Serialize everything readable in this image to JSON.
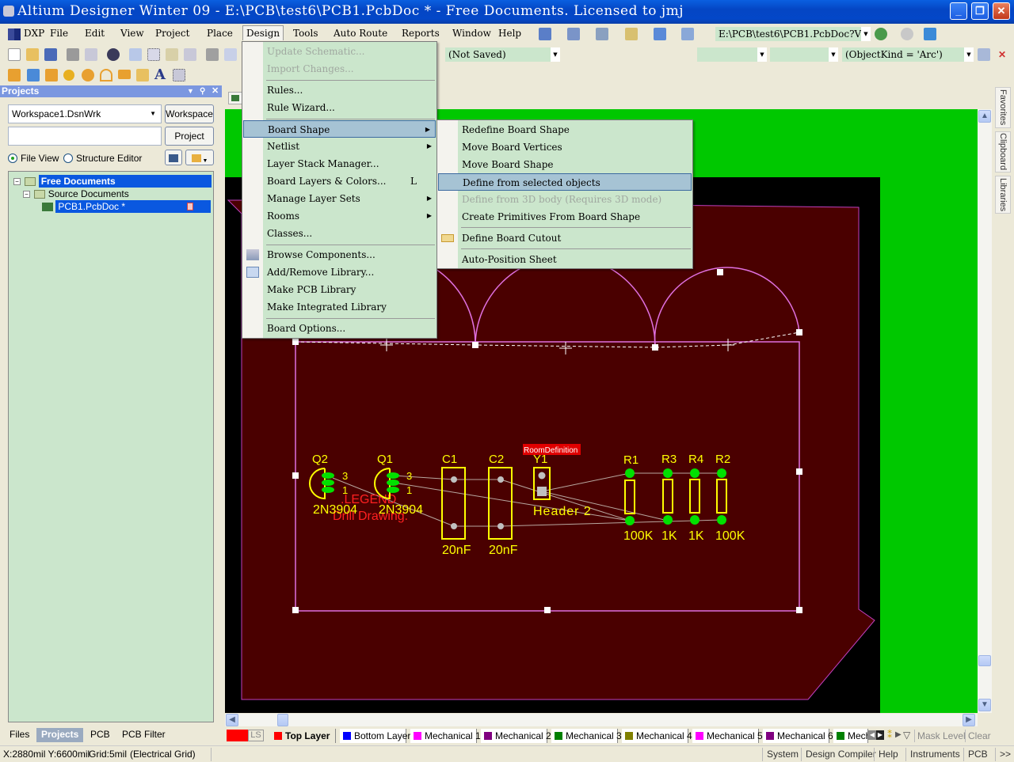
{
  "window": {
    "title": "Altium Designer Winter 09 - E:\\PCB\\test6\\PCB1.PcbDoc * - Free Documents. Licensed to jmj",
    "minimize": "_",
    "restore": "❐",
    "close": "✕"
  },
  "menubar": {
    "items": [
      "DXP",
      "File",
      "Edit",
      "View",
      "Project",
      "Place",
      "Design",
      "Tools",
      "Auto Route",
      "Reports",
      "Window",
      "Help"
    ],
    "open_menu": "Design"
  },
  "toolbar": {
    "path_combo": "E:\\PCB\\test6\\PCB1.PcbDoc?V",
    "variant_combo": "(Not Saved)",
    "filter_combo": "(ObjectKind = 'Arc')",
    "combo_empty_1": "",
    "combo_empty_2": ""
  },
  "projects_panel": {
    "title": "Projects",
    "workspace_value": "Workspace1.DsnWrk",
    "project_value": "",
    "workspace_button": "Workspace",
    "project_button": "Project",
    "file_view_label": "File View",
    "structure_editor_label": "Structure Editor",
    "view_mode": "File View",
    "tree": [
      {
        "label": "Free Documents",
        "level": 0,
        "selected": true
      },
      {
        "label": "Source Documents",
        "level": 1,
        "selected": false
      },
      {
        "label": "PCB1.PcbDoc *",
        "level": 2,
        "selected": true
      }
    ],
    "tabs": [
      "Files",
      "Projects",
      "PCB",
      "PCB Filter"
    ],
    "active_tab": "Projects"
  },
  "design_menu": {
    "items": [
      {
        "label": "Update Schematic...",
        "disabled": true
      },
      {
        "label": "Import Changes...",
        "disabled": true
      },
      {
        "label": "Rules..."
      },
      {
        "label": "Rule Wizard..."
      },
      {
        "label": "Board Shape",
        "submenu": true,
        "highlighted": true
      },
      {
        "label": "Netlist",
        "submenu": true
      },
      {
        "label": "Layer Stack Manager..."
      },
      {
        "label": "Board Layers & Colors...",
        "shortcut": "L"
      },
      {
        "label": "Manage Layer Sets",
        "submenu": true
      },
      {
        "label": "Rooms",
        "submenu": true
      },
      {
        "label": "Classes..."
      },
      {
        "label": "Browse Components...",
        "icon": "browse-components-icon"
      },
      {
        "label": "Add/Remove Library...",
        "icon": "library-book-icon"
      },
      {
        "label": "Make PCB Library"
      },
      {
        "label": "Make Integrated Library"
      },
      {
        "label": "Board Options..."
      }
    ]
  },
  "board_shape_menu": {
    "items": [
      {
        "label": "Redefine Board Shape"
      },
      {
        "label": "Move Board Vertices"
      },
      {
        "label": "Move Board Shape"
      },
      {
        "label": "Define from selected objects",
        "highlighted": true
      },
      {
        "label": "Define from 3D body (Requires 3D mode)",
        "disabled": true
      },
      {
        "label": "Create Primitives From Board Shape"
      },
      {
        "label": "Define Board Cutout",
        "icon": "board-cutout-icon"
      },
      {
        "label": "Auto-Position Sheet"
      }
    ]
  },
  "pcb": {
    "room_label": "RoomDefinition",
    "components": [
      {
        "designator": "Q2",
        "comment": "2N3904"
      },
      {
        "designator": "Q1",
        "comment": "2N3904"
      },
      {
        "designator": "C1",
        "comment": "20nF"
      },
      {
        "designator": "C2",
        "comment": "20nF"
      },
      {
        "designator": "Y1",
        "comment": "Header 2"
      },
      {
        "designator": "R1",
        "comment": "100K"
      },
      {
        "designator": "R3",
        "comment": "1K"
      },
      {
        "designator": "R4",
        "comment": "1K"
      },
      {
        "designator": "R2",
        "comment": "100K"
      }
    ],
    "pin_labels": [
      "3",
      "1",
      "3",
      "1"
    ],
    "legend_text": ".LEGEND",
    "drill_text": "Drill Drawing.",
    "colors": {
      "board": "#4a0000",
      "background": "#000000",
      "sheet": "#00c800",
      "outline": "#d050d0",
      "silkscreen": "#ffff00",
      "pad": "#00e000",
      "legend": "#ff2020"
    }
  },
  "right_tabs": [
    "Favorites",
    "Clipboard",
    "Libraries"
  ],
  "layers": {
    "ls_label": "LS",
    "tabs": [
      {
        "label": "Top Layer",
        "color": "#ff0000",
        "active": true
      },
      {
        "label": "Bottom Layer",
        "color": "#0000ff"
      },
      {
        "label": "Mechanical 1",
        "color": "#ff00ff"
      },
      {
        "label": "Mechanical 2",
        "color": "#800080"
      },
      {
        "label": "Mechanical 3",
        "color": "#008000"
      },
      {
        "label": "Mechanical 4",
        "color": "#808000"
      },
      {
        "label": "Mechanical 5",
        "color": "#ff00ff"
      },
      {
        "label": "Mechanical 6",
        "color": "#800080"
      },
      {
        "label": "Mech",
        "color": "#008000"
      }
    ],
    "mask_level": "Mask Level",
    "clear": "Clear"
  },
  "status": {
    "coords": "X:2880mil Y:6600mil",
    "grid": "Grid:5mil",
    "grid_type": "(Electrical Grid)",
    "buttons": [
      "System",
      "Design Compiler",
      "Help",
      "Instruments",
      "PCB",
      ">>"
    ]
  }
}
